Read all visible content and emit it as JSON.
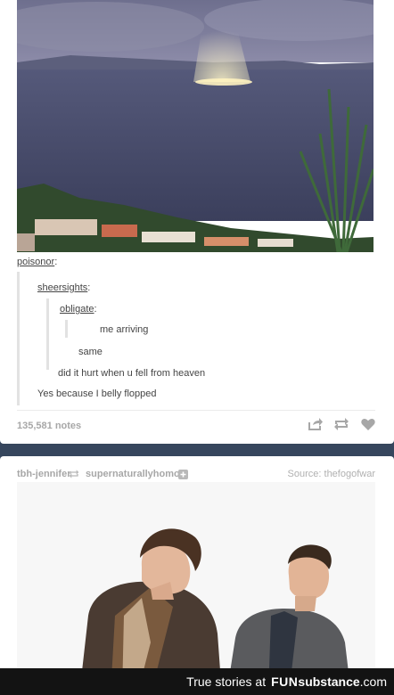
{
  "post1": {
    "photo_alt": "sea with light beam",
    "caption_user": "poisonor",
    "quote1_user": "sheersights",
    "quote2_user": "obligate",
    "quote3_text": "me arriving",
    "line_same": "same",
    "line_hurt": "did it hurt when u fell from heaven",
    "line_yes": "Yes because I belly flopped",
    "notes": "135,581 notes",
    "icons": [
      "share-icon",
      "reblog-icon",
      "heart-icon"
    ]
  },
  "post2": {
    "blog_from": "tbh-jennifer",
    "blog_to": "supernaturallyhomo",
    "source": "Source: thefogofwar",
    "icons": [
      "reblog-small-icon",
      "follow-plus-icon"
    ]
  },
  "footer": {
    "prefix": "True stories at",
    "brand_fun": "FUN",
    "brand_sub": "substance",
    "brand_com": ".com"
  },
  "colors": {
    "background": "#36465d",
    "card": "#ffffff",
    "footer": "#131313"
  }
}
